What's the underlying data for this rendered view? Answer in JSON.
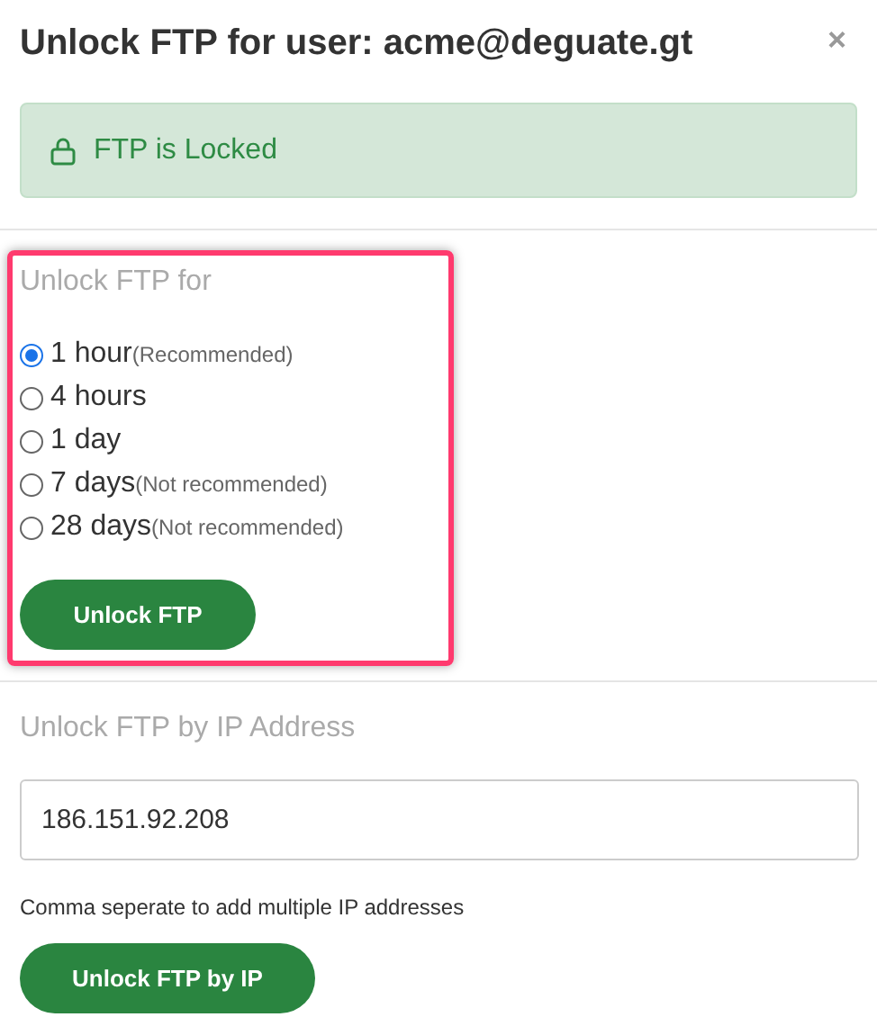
{
  "dialog": {
    "title": "Unlock FTP for user: acme@deguate.gt",
    "close": "×"
  },
  "alert": {
    "text": "FTP is Locked"
  },
  "duration_section": {
    "highlighted": true,
    "label": "Unlock FTP for",
    "options": [
      {
        "label": "1 hour",
        "note": "(Recommended)",
        "selected": true
      },
      {
        "label": "4 hours",
        "selected": false
      },
      {
        "label": "1 day",
        "selected": false
      },
      {
        "label": "7 days",
        "note": "(Not recommended)",
        "selected": false
      },
      {
        "label": "28 days",
        "note": "(Not recommended)",
        "selected": false
      }
    ],
    "button": "Unlock FTP"
  },
  "ip_section": {
    "label": "Unlock FTP by IP Address",
    "value": "186.151.92.208",
    "help": "Comma seperate to add multiple IP addresses",
    "button": "Unlock FTP by IP"
  }
}
